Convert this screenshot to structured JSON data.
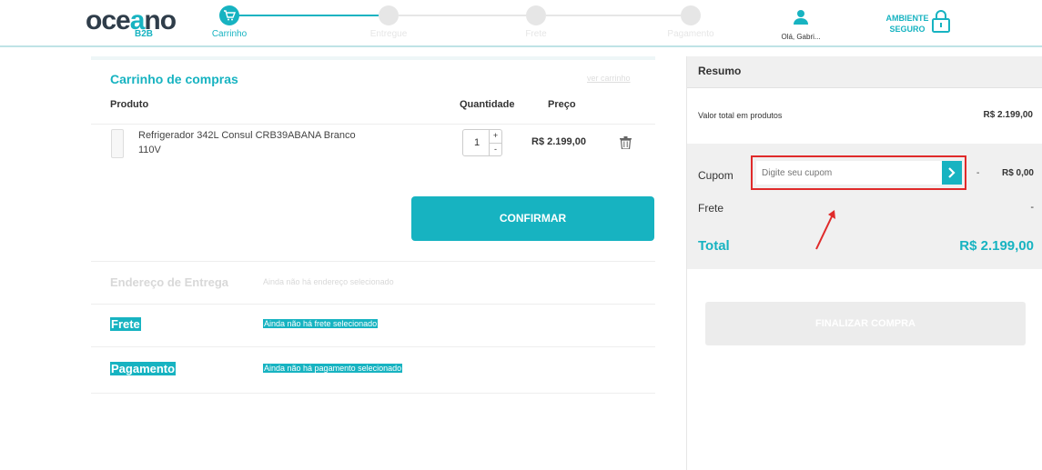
{
  "header": {
    "logo_text_a": "oce",
    "logo_text_b": "a",
    "logo_text_c": "no",
    "logo_sub": "B2B",
    "steps": [
      {
        "label": "Carrinho",
        "state": "active",
        "icon": "cart-icon"
      },
      {
        "label": "Entregue",
        "state": "pending",
        "icon": "step-2-icon"
      },
      {
        "label": "Frete",
        "state": "pending",
        "icon": "step-3-icon"
      },
      {
        "label": "Pagamento",
        "state": "pending",
        "icon": "step-4-icon"
      }
    ],
    "user_greeting": "Olá, Gabri...",
    "secure_line1": "AMBIENTE",
    "secure_line2": "SEGURO"
  },
  "cart": {
    "title": "Carrinho de compras",
    "see_cart": "ver carrinho",
    "columns": {
      "product": "Produto",
      "quantity": "Quantidade",
      "price": "Preço"
    },
    "items": [
      {
        "name": "Refrigerador 342L Consul CRB39ABANA Branco 110V",
        "quantity": "1",
        "price": "R$ 2.199,00"
      }
    ],
    "confirm_label": "CONFIRMAR"
  },
  "sections": {
    "delivery": {
      "title": "Endereço de Entrega",
      "note": "Ainda não há endereço selecionado"
    },
    "shipping": {
      "title": "Frete",
      "note": "Ainda não há frete selecionado"
    },
    "payment": {
      "title": "Pagamento",
      "note": "Ainda não há pagamento selecionado"
    }
  },
  "summary": {
    "title": "Resumo",
    "products_total_label": "Valor total em produtos",
    "products_total_value": "R$ 2.199,00",
    "coupon_label": "Cupom",
    "coupon_placeholder": "Digite seu cupom",
    "coupon_dash": "-",
    "coupon_value": "R$ 0,00",
    "shipping_label": "Frete",
    "shipping_value": "-",
    "total_label": "Total",
    "total_value": "R$ 2.199,00",
    "finalize_label": "FINALIZAR COMPRA"
  },
  "colors": {
    "accent": "#17b3c1",
    "dark_text": "#2f3d4a",
    "highlight_box": "#e02a2a"
  }
}
